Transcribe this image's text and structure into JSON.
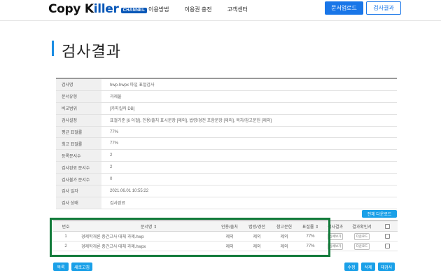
{
  "header": {
    "logo_text_a": "Copy K",
    "logo_text_b": "iller",
    "logo_badge": "CHANNEL",
    "nav": [
      "이용방법",
      "이용권 충전",
      "고객센터"
    ],
    "upload_label": "문서업로드",
    "results_label": "검사결과"
  },
  "page": {
    "title": "검사결과"
  },
  "info_rows": [
    {
      "label": "검사명",
      "value": "hwp-hwpx 파일 표절검사"
    },
    {
      "label": "문서유형",
      "value": "과제물"
    },
    {
      "label": "비교범위",
      "value": "[카피킬러 DB]"
    },
    {
      "label": "검사설정",
      "value": "표절기준 [6 어절], 인용/출처 표시문장 [제외], 법령/경전 포함문장 [제외], 목차/참고문헌 [제외]"
    },
    {
      "label": "평균 표절률",
      "value": "77%"
    },
    {
      "label": "최고 표절률",
      "value": "77%"
    },
    {
      "label": "등록문서수",
      "value": "2"
    },
    {
      "label": "검사완료 문서수",
      "value": "2"
    },
    {
      "label": "검사불가 문서수",
      "value": "0"
    },
    {
      "label": "검사 일자",
      "value": "2021.06.01 10:55:22"
    },
    {
      "label": "검사 상태",
      "value": "검사완료"
    }
  ],
  "download_all_label": "전체 다운로드",
  "doc_table": {
    "headers": {
      "no": "번호",
      "name": "문서명 ⇕",
      "quote": "인용/출처",
      "law": "법령/경전",
      "ref": "참고문헌",
      "rate": "표절률 ⇕",
      "result": "검사결과",
      "confirm": "결과확인서"
    },
    "rows": [
      {
        "no": "1",
        "name": "경제학개론 중간고사 대체 과제.hwp",
        "quote": "제외",
        "law": "제외",
        "ref": "제외",
        "rate": "77%",
        "result": "상세보기",
        "confirm": "다운로드"
      },
      {
        "no": "2",
        "name": "경제학개론 중간고사 대체 과제.hwpx",
        "quote": "제외",
        "law": "제외",
        "ref": "제외",
        "rate": "77%",
        "result": "상세보기",
        "confirm": "다운로드"
      }
    ]
  },
  "bottom_buttons": {
    "list": "목록",
    "new_check": "새로고침",
    "edit": "수정",
    "delete": "삭제",
    "recheck": "재검사"
  },
  "colors": {
    "brand_blue": "#1976e8",
    "accent_cyan": "#1aa0e8",
    "highlight_green": "#137b3b"
  }
}
